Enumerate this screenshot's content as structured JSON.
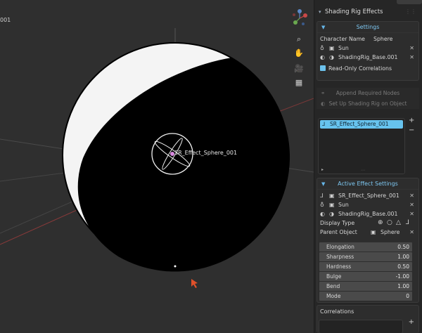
{
  "viewport": {
    "corner_text": "001",
    "object_label": "SR_Effect_Sphere_001"
  },
  "sidebar": {
    "header_title": "Shading Rig Effects",
    "settings": {
      "title": "Settings",
      "character_name_label": "Character Name",
      "character_name_value": "Sphere",
      "items": [
        {
          "icon": "light-icon",
          "label": "Sun"
        },
        {
          "icon": "material-icon",
          "label": "ShadingRig_Base.001"
        }
      ],
      "read_only_label": "Read-Only Correlations"
    },
    "append_button": "Append Required Nodes",
    "setup_button": "Set Up Shading Rig on Object",
    "effects_list": [
      "SR_Effect_Sphere_001"
    ],
    "active_effect": {
      "title": "Active Effect Settings",
      "items": [
        {
          "label": "SR_Effect_Sphere_001"
        },
        {
          "label": "Sun"
        },
        {
          "label": "ShadingRig_Base.001"
        }
      ],
      "display_type_label": "Display Type",
      "parent_object_label": "Parent Object",
      "parent_object_value": "Sphere",
      "properties": [
        {
          "name": "Elongation",
          "value": "0.50"
        },
        {
          "name": "Sharpness",
          "value": "1.00"
        },
        {
          "name": "Hardness",
          "value": "0.50"
        },
        {
          "name": "Bulge",
          "value": "-1.00"
        },
        {
          "name": "Bend",
          "value": "1.00"
        },
        {
          "name": "Mode",
          "value": "0"
        }
      ]
    },
    "correlations_title": "Correlations"
  },
  "colors": {
    "accent": "#67c3ee",
    "axis_red": "#b04545",
    "cursor": "#e0502a"
  }
}
